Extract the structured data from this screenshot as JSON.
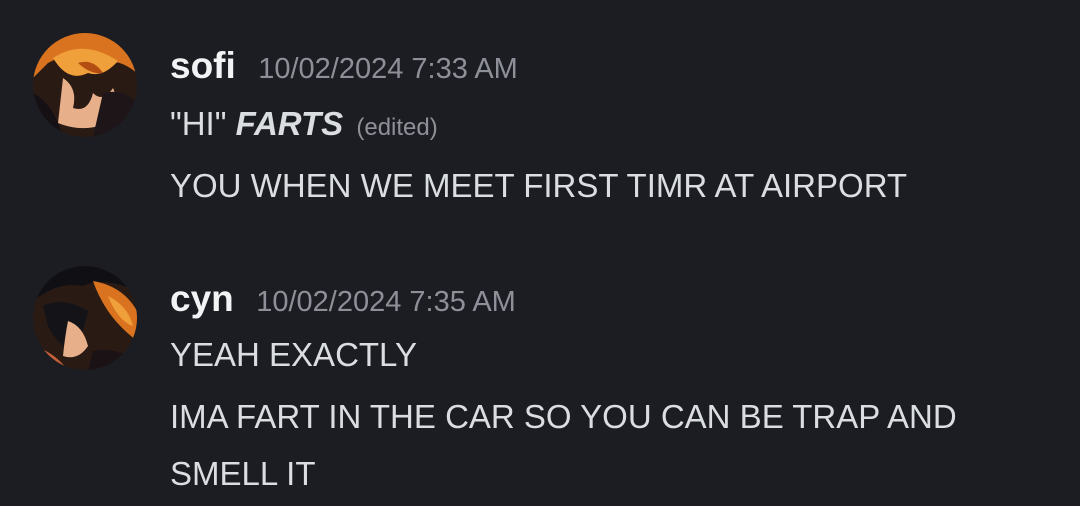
{
  "messages": [
    {
      "username": "sofi",
      "timestamp": "10/02/2024 7:33 AM",
      "avatar_icon": "avatar-sofi-icon",
      "lines": [
        {
          "prefix": "\"HI\" ",
          "emphasis": "FARTS",
          "edited": "(edited)"
        },
        {
          "text": "YOU WHEN WE MEET FIRST TIMR AT AIRPORT"
        }
      ]
    },
    {
      "username": "cyn",
      "timestamp": "10/02/2024 7:35 AM",
      "avatar_icon": "avatar-cyn-icon",
      "lines": [
        {
          "text": "YEAH EXACTLY"
        },
        {
          "text": "IMA FART IN THE CAR SO YOU CAN BE TRAP AND"
        },
        {
          "text": "SMELL IT"
        }
      ]
    }
  ],
  "colors": {
    "background": "#1c1d22",
    "username": "#f2f3f5",
    "timestamp": "#8e9099",
    "message_text": "#dbdee1"
  }
}
